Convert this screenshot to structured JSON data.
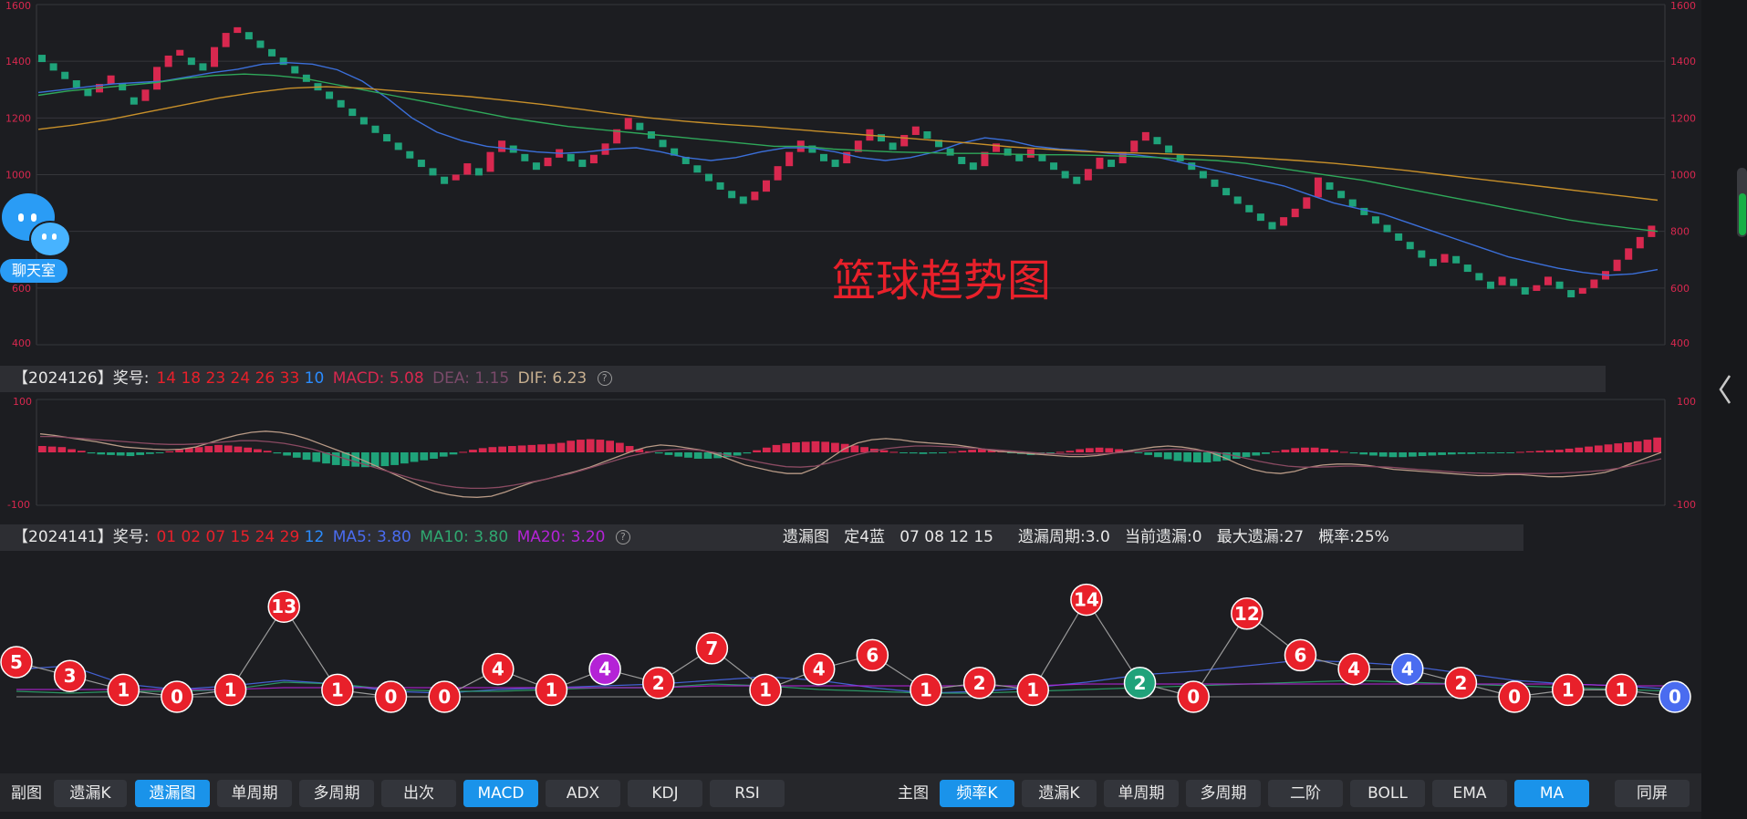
{
  "main_chart": {
    "title": "篮球趋势图",
    "y_ticks": [
      1600,
      1400,
      1200,
      1000,
      800,
      600,
      400
    ]
  },
  "chart_data": [
    {
      "type": "line",
      "title": "篮球趋势图",
      "ylim": [
        400,
        1600
      ],
      "grid": true,
      "series": [
        {
          "name": "K",
          "values": [
            1410,
            1380,
            1350,
            1320,
            1290,
            1320,
            1350,
            1310,
            1260,
            1300,
            1380,
            1420,
            1440,
            1400,
            1380,
            1450,
            1500,
            1520,
            1490,
            1460,
            1430,
            1400,
            1370,
            1340,
            1310,
            1280,
            1250,
            1220,
            1190,
            1160,
            1130,
            1100,
            1070,
            1040,
            1010,
            980,
            1000,
            1040,
            1010,
            1080,
            1120,
            1090,
            1060,
            1030,
            1060,
            1090,
            1060,
            1040,
            1070,
            1110,
            1160,
            1200,
            1170,
            1140,
            1110,
            1080,
            1050,
            1020,
            990,
            960,
            930,
            910,
            940,
            980,
            1030,
            1080,
            1120,
            1090,
            1060,
            1040,
            1080,
            1120,
            1160,
            1130,
            1100,
            1140,
            1170,
            1140,
            1110,
            1080,
            1050,
            1030,
            1080,
            1110,
            1080,
            1060,
            1090,
            1060,
            1030,
            1000,
            980,
            1020,
            1060,
            1040,
            1080,
            1120,
            1150,
            1120,
            1090,
            1060,
            1030,
            1000,
            970,
            940,
            910,
            880,
            850,
            820,
            850,
            880,
            920,
            990,
            960,
            930,
            900,
            870,
            840,
            810,
            780,
            750,
            720,
            690,
            720,
            700,
            670,
            640,
            610,
            640,
            620,
            590,
            610,
            640,
            610,
            580,
            600,
            630,
            660,
            700,
            740,
            780,
            820
          ]
        },
        {
          "name": "MA5",
          "values": [
            1290,
            1300,
            1310,
            1320,
            1325,
            1330,
            1345,
            1360,
            1372,
            1390,
            1395,
            1390,
            1370,
            1330,
            1270,
            1200,
            1150,
            1120,
            1100,
            1090,
            1080,
            1075,
            1080,
            1090,
            1095,
            1080,
            1060,
            1050,
            1060,
            1080,
            1095,
            1095,
            1080,
            1060,
            1050,
            1060,
            1080,
            1110,
            1130,
            1120,
            1100,
            1090,
            1085,
            1075,
            1070,
            1060,
            1040,
            1020,
            1000,
            980,
            960,
            930,
            900,
            880,
            860,
            830,
            800,
            770,
            740,
            710,
            690,
            670,
            655,
            645,
            650,
            665
          ]
        },
        {
          "name": "MA10",
          "values": [
            1280,
            1295,
            1305,
            1315,
            1325,
            1340,
            1350,
            1355,
            1350,
            1340,
            1320,
            1300,
            1280,
            1260,
            1240,
            1220,
            1200,
            1185,
            1170,
            1160,
            1150,
            1140,
            1130,
            1120,
            1110,
            1100,
            1100,
            1090,
            1085,
            1080,
            1078,
            1075,
            1075,
            1072,
            1070,
            1070,
            1068,
            1065,
            1060,
            1055,
            1050,
            1040,
            1025,
            1010,
            995,
            980,
            960,
            940,
            920,
            900,
            880,
            860,
            840,
            825,
            812,
            800
          ]
        },
        {
          "name": "MA20",
          "values": [
            1160,
            1175,
            1195,
            1220,
            1245,
            1270,
            1290,
            1305,
            1310,
            1305,
            1295,
            1285,
            1275,
            1262,
            1248,
            1232,
            1215,
            1200,
            1188,
            1178,
            1170,
            1160,
            1150,
            1140,
            1130,
            1120,
            1110,
            1098,
            1090,
            1082,
            1078,
            1075,
            1070,
            1065,
            1058,
            1050,
            1040,
            1028,
            1015,
            1000,
            985,
            970,
            955,
            940,
            925,
            910
          ]
        }
      ]
    },
    {
      "type": "bar",
      "title": "MACD",
      "ylim": [
        -100,
        100
      ],
      "series": [
        {
          "name": "MACD",
          "values": [
            12,
            11,
            10,
            6,
            3,
            -2,
            -4,
            -5,
            -6,
            -7,
            -5,
            -3,
            -1,
            2,
            5,
            8,
            10,
            12,
            14,
            13,
            11,
            9,
            6,
            3,
            -2,
            -6,
            -10,
            -14,
            -18,
            -21,
            -24,
            -26,
            -27,
            -28,
            -27,
            -26,
            -24,
            -21,
            -18,
            -15,
            -12,
            -8,
            -4,
            1,
            5,
            8,
            10,
            11,
            12,
            13,
            14,
            15,
            16,
            18,
            22,
            24,
            25,
            24,
            22,
            18,
            12,
            6,
            2,
            -2,
            -5,
            -8,
            -10,
            -12,
            -12,
            -11,
            -9,
            -6,
            -2,
            4,
            9,
            14,
            17,
            19,
            20,
            21,
            20,
            18,
            16,
            13,
            10,
            7,
            4,
            1,
            -1,
            -2,
            -3,
            -2,
            -1,
            1,
            3,
            5,
            6,
            4,
            2,
            -1,
            -3,
            -5,
            -4,
            -2,
            1,
            3,
            6,
            8,
            9,
            8,
            6,
            3,
            -1,
            -5,
            -9,
            -13,
            -16,
            -18,
            -19,
            -19,
            -17,
            -15,
            -12,
            -9,
            -6,
            -3,
            2,
            5,
            8,
            9,
            9,
            7,
            4,
            1,
            -2,
            -4,
            -6,
            -8,
            -9,
            -9,
            -8,
            -7,
            -6,
            -5,
            -4,
            -3,
            -3,
            -2,
            -2,
            -1,
            -1,
            1,
            2,
            3,
            4,
            5,
            7,
            9,
            11,
            13,
            15,
            17,
            19,
            21,
            24,
            28
          ]
        },
        {
          "name": "DIF",
          "values": [
            35,
            32,
            28,
            24,
            20,
            15,
            10,
            8,
            6,
            5,
            6,
            10,
            18,
            26,
            33,
            38,
            40,
            38,
            33,
            25,
            15,
            5,
            -5,
            -16,
            -28,
            -40,
            -52,
            -64,
            -74,
            -80,
            -84,
            -85,
            -83,
            -75,
            -65,
            -56,
            -50,
            -43,
            -36,
            -28,
            -18,
            -8,
            2,
            10,
            14,
            12,
            8,
            4,
            -4,
            -14,
            -24,
            -30,
            -36,
            -40,
            -40,
            -30,
            -12,
            6,
            18,
            24,
            26,
            24,
            20,
            18,
            16,
            14,
            10,
            6,
            2,
            0,
            -2,
            -4,
            -6,
            -8,
            -8,
            -6,
            -2,
            2,
            6,
            10,
            12,
            10,
            6,
            0,
            -10,
            -22,
            -32,
            -38,
            -40,
            -36,
            -28,
            -24,
            -22,
            -22,
            -24,
            -28,
            -32,
            -34,
            -36,
            -38,
            -40,
            -42,
            -44,
            -44,
            -42,
            -42,
            -44,
            -46,
            -46,
            -44,
            -42,
            -38,
            -30,
            -20,
            -10,
            0
          ]
        },
        {
          "name": "DEA",
          "values": [
            30,
            30,
            28,
            26,
            24,
            22,
            20,
            18,
            16,
            15,
            15,
            16,
            18,
            20,
            22,
            22,
            20,
            17,
            12,
            6,
            -2,
            -10,
            -18,
            -26,
            -34,
            -42,
            -50,
            -56,
            -62,
            -66,
            -68,
            -68,
            -66,
            -62,
            -57,
            -52,
            -46,
            -40,
            -32,
            -24,
            -16,
            -8,
            -2,
            3,
            5,
            6,
            4,
            0,
            -6,
            -12,
            -18,
            -23,
            -27,
            -28,
            -26,
            -20,
            -12,
            -4,
            2,
            7,
            10,
            12,
            12,
            11,
            10,
            8,
            6,
            4,
            2,
            0,
            -2,
            -3,
            -4,
            -4,
            -3,
            -1,
            1,
            3,
            5,
            6,
            5,
            3,
            0,
            -5,
            -11,
            -17,
            -22,
            -26,
            -28,
            -28,
            -27,
            -26,
            -26,
            -27,
            -28,
            -30,
            -32,
            -34,
            -36,
            -38,
            -39,
            -40,
            -40,
            -40,
            -40,
            -40,
            -39,
            -38,
            -36,
            -34,
            -30,
            -25,
            -19,
            -12
          ]
        }
      ]
    },
    {
      "type": "line",
      "title": "遗漏图",
      "series": [
        {
          "name": "遗漏",
          "values": [
            5,
            3,
            1,
            0,
            1,
            13,
            1,
            0,
            0,
            4,
            1,
            4,
            2,
            7,
            1,
            4,
            6,
            1,
            2,
            1,
            14,
            2,
            0,
            12,
            6,
            4,
            4,
            2,
            0,
            1,
            1,
            0
          ]
        }
      ]
    }
  ],
  "macd_bar": {
    "period_label": "【2024126】",
    "prize_label": "奖号:",
    "red_numbers": "14 18 23 24 26 33",
    "blue_number": "10",
    "macd_label": "MACD:",
    "macd_value": "5.08",
    "dea_label": "DEA:",
    "dea_value": "1.15",
    "dif_label": "DIF:",
    "dif_value": "6.23",
    "help": "?",
    "axis_top": "100",
    "axis_bottom": "-100"
  },
  "miss_bar": {
    "period_label": "【2024141】",
    "prize_label": "奖号:",
    "red_numbers": "01 02 07 15 24 29",
    "blue_number": "12",
    "ma5_label": "MA5:",
    "ma5_value": "3.80",
    "ma10_label": "MA10:",
    "ma10_value": "3.80",
    "ma20_label": "MA20:",
    "ma20_value": "3.20",
    "help": "?",
    "stats": "遗漏图   定4蓝   07 08 12 15     遗漏周期:3.0   当前遗漏:0   最大遗漏:27   概率:25%"
  },
  "chat": {
    "label": "聊天室"
  },
  "bottom_bar": {
    "sub_label": "副图",
    "sub_buttons": [
      "遗漏K",
      "遗漏图",
      "单周期",
      "多周期",
      "出次",
      "MACD",
      "ADX",
      "KDJ",
      "RSI"
    ],
    "main_label": "主图",
    "main_buttons": [
      "频率K",
      "遗漏K",
      "单周期",
      "多周期",
      "二阶",
      "BOLL",
      "EMA",
      "MA"
    ],
    "sync_button": "同屏"
  },
  "colors": {
    "up": "#d8284f",
    "down": "#1fa37a",
    "ma5": "#3b6fd9",
    "ma10": "#2fa85a",
    "ma20": "#c8902a",
    "accent": "#1a93ea",
    "red_ball": "#e8202a",
    "blue_ball": "#4a6cf0",
    "purple_ball": "#b423d6",
    "green_ball": "#20a27a"
  }
}
